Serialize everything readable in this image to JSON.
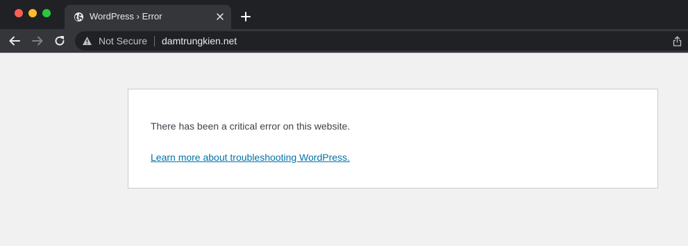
{
  "tab": {
    "title": "WordPress › Error"
  },
  "omnibox": {
    "security_label": "Not Secure",
    "url": "damtrungkien.net"
  },
  "page": {
    "message": "There has been a critical error on this website.",
    "link_text": "Learn more about troubleshooting WordPress."
  },
  "icons": {
    "favicon": "globe-icon",
    "tab_close": "close-icon",
    "new_tab": "plus-icon",
    "back": "back-arrow-icon",
    "forward": "forward-arrow-icon",
    "reload": "reload-icon",
    "security": "warning-icon",
    "share": "share-icon"
  },
  "colors": {
    "tabstrip_bg": "#202124",
    "toolbar_bg": "#35363a",
    "page_bg": "#f1f1f1",
    "link": "#0073aa",
    "text": "#3c434a"
  }
}
